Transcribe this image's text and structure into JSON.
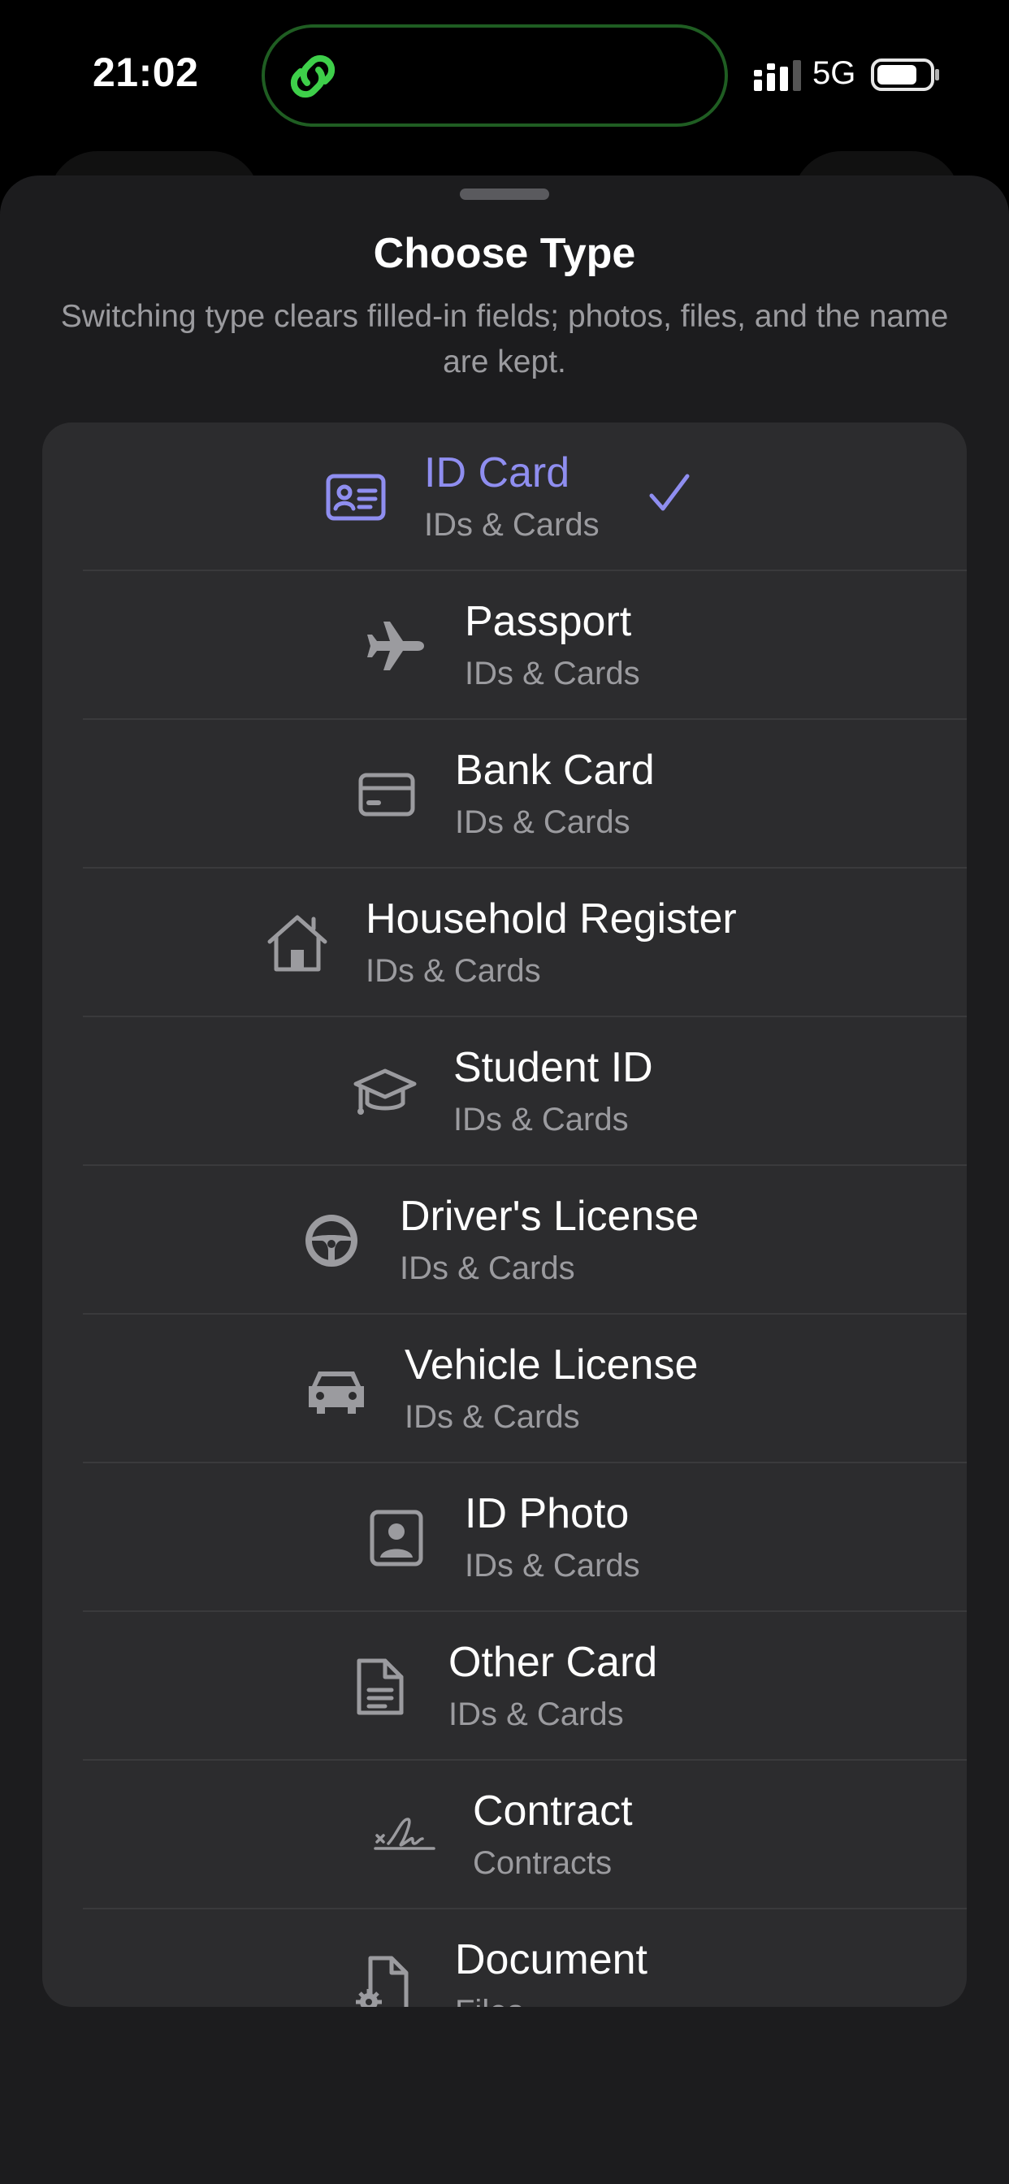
{
  "status_bar": {
    "time": "21:02",
    "network": "5G"
  },
  "sheet": {
    "title": "Choose Type",
    "subtitle": "Switching type clears filled-in fields; photos, files, and the name are kept."
  },
  "colors": {
    "accent": "#8f8ef0",
    "icon_gray": "#9b9b9f",
    "sheet_bg": "#1c1c1e",
    "list_bg": "#2c2c2e",
    "island_border": "#1f5d22",
    "island_icon": "#3ecf4a"
  },
  "types": [
    {
      "title": "ID Card",
      "subtitle": "IDs & Cards",
      "icon": "id-card-icon",
      "selected": true
    },
    {
      "title": "Passport",
      "subtitle": "IDs & Cards",
      "icon": "airplane-icon",
      "selected": false
    },
    {
      "title": "Bank Card",
      "subtitle": "IDs & Cards",
      "icon": "credit-card-icon",
      "selected": false
    },
    {
      "title": "Household Register",
      "subtitle": "IDs & Cards",
      "icon": "house-icon",
      "selected": false
    },
    {
      "title": "Student ID",
      "subtitle": "IDs & Cards",
      "icon": "graduation-cap-icon",
      "selected": false
    },
    {
      "title": "Driver's License",
      "subtitle": "IDs & Cards",
      "icon": "steering-wheel-icon",
      "selected": false
    },
    {
      "title": "Vehicle License",
      "subtitle": "IDs & Cards",
      "icon": "car-icon",
      "selected": false
    },
    {
      "title": "ID Photo",
      "subtitle": "IDs & Cards",
      "icon": "portrait-icon",
      "selected": false
    },
    {
      "title": "Other Card",
      "subtitle": "IDs & Cards",
      "icon": "document-text-icon",
      "selected": false
    },
    {
      "title": "Contract",
      "subtitle": "Contracts",
      "icon": "signature-icon",
      "selected": false
    },
    {
      "title": "Document",
      "subtitle": "Files",
      "icon": "document-gear-icon",
      "selected": false
    }
  ]
}
